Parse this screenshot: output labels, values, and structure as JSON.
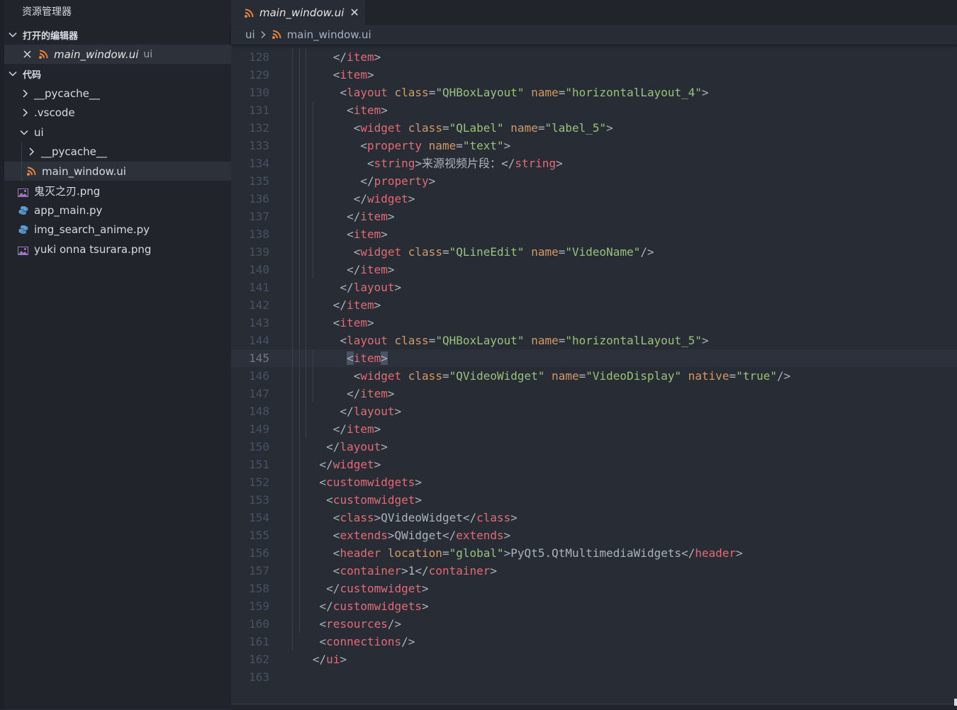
{
  "sidebar": {
    "title": "资源管理器",
    "open_editors": {
      "label": "打开的编辑器",
      "items": [
        {
          "name": "main_window.ui",
          "folder": "ui"
        }
      ]
    },
    "workspace": {
      "label": "代码",
      "tree": [
        {
          "label": "__pycache__",
          "type": "folder",
          "expanded": false
        },
        {
          "label": ".vscode",
          "type": "folder",
          "expanded": false
        },
        {
          "label": "ui",
          "type": "folder",
          "expanded": true
        },
        {
          "label": "__pycache__",
          "type": "folder",
          "expanded": false
        },
        {
          "label": "main_window.ui",
          "type": "file",
          "icon": "feed-icon",
          "selected": true
        },
        {
          "label": "鬼灭之刃.png",
          "type": "file",
          "icon": "image-icon"
        },
        {
          "label": "app_main.py",
          "type": "file",
          "icon": "python-icon"
        },
        {
          "label": "img_search_anime.py",
          "type": "file",
          "icon": "python-icon"
        },
        {
          "label": "yuki onna tsurara.png",
          "type": "file",
          "icon": "image-icon"
        }
      ]
    }
  },
  "tab": {
    "label": "main_window.ui",
    "close": "✕"
  },
  "breadcrumb": {
    "folder": "ui",
    "file": "main_window.ui"
  },
  "editor": {
    "current_line": 145,
    "lines": [
      {
        "n": "128",
        "text": "      </item>"
      },
      {
        "n": "129",
        "text": "      <item>"
      },
      {
        "n": "130",
        "text": "       <layout class=\"QHBoxLayout\" name=\"horizontalLayout_4\">"
      },
      {
        "n": "131",
        "text": "        <item>"
      },
      {
        "n": "132",
        "text": "         <widget class=\"QLabel\" name=\"label_5\">"
      },
      {
        "n": "133",
        "text": "          <property name=\"text\">"
      },
      {
        "n": "134",
        "text": "           <string>来源视频片段：</string>"
      },
      {
        "n": "135",
        "text": "          </property>"
      },
      {
        "n": "136",
        "text": "         </widget>"
      },
      {
        "n": "137",
        "text": "        </item>"
      },
      {
        "n": "138",
        "text": "        <item>"
      },
      {
        "n": "139",
        "text": "         <widget class=\"QLineEdit\" name=\"VideoName\"/>"
      },
      {
        "n": "140",
        "text": "        </item>"
      },
      {
        "n": "141",
        "text": "       </layout>"
      },
      {
        "n": "142",
        "text": "      </item>"
      },
      {
        "n": "143",
        "text": "      <item>"
      },
      {
        "n": "144",
        "text": "       <layout class=\"QHBoxLayout\" name=\"horizontalLayout_5\">"
      },
      {
        "n": "145",
        "text": "        <item>"
      },
      {
        "n": "146",
        "text": "         <widget class=\"QVideoWidget\" name=\"VideoDisplay\" native=\"true\"/>"
      },
      {
        "n": "147",
        "text": "        </item>"
      },
      {
        "n": "148",
        "text": "       </layout>"
      },
      {
        "n": "149",
        "text": "      </item>"
      },
      {
        "n": "150",
        "text": "     </layout>"
      },
      {
        "n": "151",
        "text": "    </widget>"
      },
      {
        "n": "152",
        "text": "    <customwidgets>"
      },
      {
        "n": "153",
        "text": "     <customwidget>"
      },
      {
        "n": "154",
        "text": "      <class>QVideoWidget</class>"
      },
      {
        "n": "155",
        "text": "      <extends>QWidget</extends>"
      },
      {
        "n": "156",
        "text": "      <header location=\"global\">PyQt5.QtMultimediaWidgets</header>"
      },
      {
        "n": "157",
        "text": "      <container>1</container>"
      },
      {
        "n": "158",
        "text": "     </customwidget>"
      },
      {
        "n": "159",
        "text": "    </customwidgets>"
      },
      {
        "n": "160",
        "text": "    <resources/>"
      },
      {
        "n": "161",
        "text": "    <connections/>"
      },
      {
        "n": "162",
        "text": "   </ui>"
      },
      {
        "n": "163",
        "text": ""
      }
    ]
  },
  "colors": {
    "background": "#282c34",
    "sidebar": "#21252b",
    "tag": "#e06c75",
    "attribute": "#d19a66",
    "string": "#98c379",
    "text": "#abb2bf",
    "line_number": "#495162",
    "feed_icon": "#e8823e",
    "python_icon": "#5aa0d8"
  }
}
